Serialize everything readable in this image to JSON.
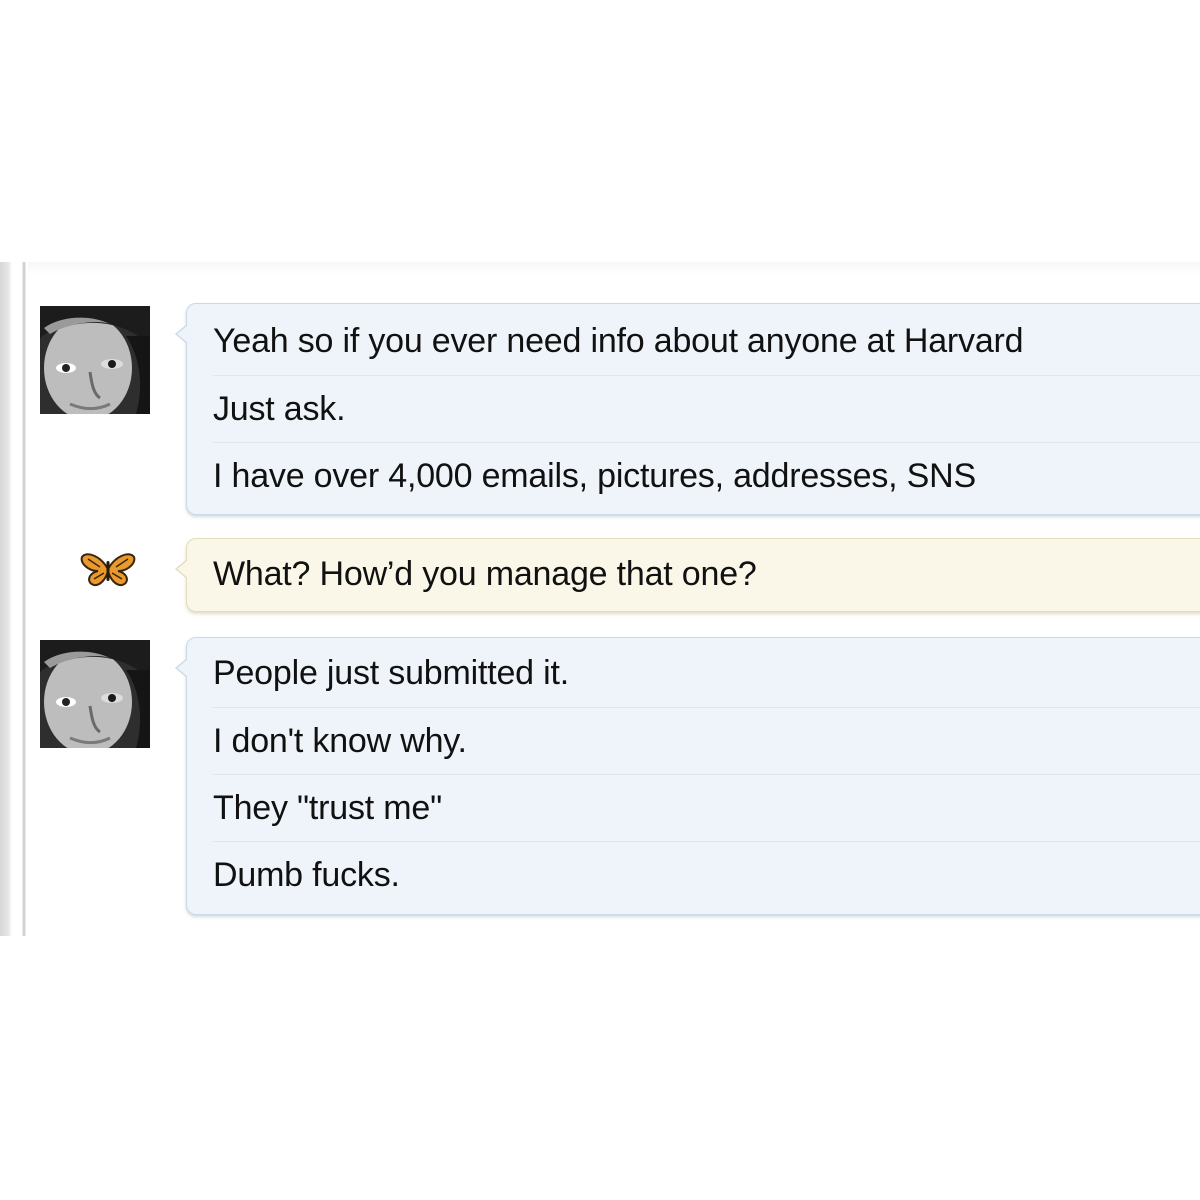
{
  "conversation": {
    "messages": [
      {
        "sender": "user",
        "lines": [
          "Yeah so if you ever need info about anyone at Harvard",
          "Just ask.",
          "I have over 4,000 emails, pictures, addresses, SNS"
        ]
      },
      {
        "sender": "friend",
        "lines": [
          "What? How’d you manage that one?"
        ]
      },
      {
        "sender": "user",
        "lines": [
          "People just submitted it.",
          "I don't know why.",
          "They \"trust me\"",
          "Dumb fucks."
        ]
      }
    ]
  },
  "colors": {
    "bubble_blue": "#eef4fa",
    "bubble_yellow": "#fbf7e8",
    "text": "#111111"
  },
  "icons": {
    "user_avatar": "user-photo-avatar",
    "friend_avatar": "butterfly-icon"
  }
}
